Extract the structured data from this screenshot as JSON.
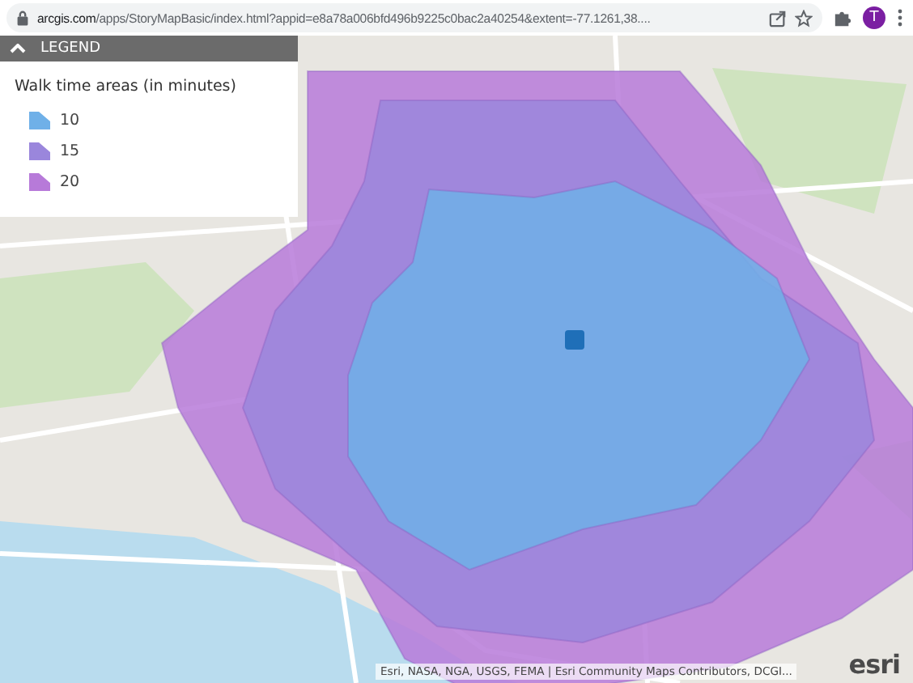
{
  "browser": {
    "url_domain": "arcgis.com",
    "url_path": "/apps/StoryMapBasic/index.html?appid=e8a78a006bfd496b9225c0bac2a40254&extent=-77.1261,38....",
    "avatar": "T"
  },
  "legend": {
    "title": "LEGEND",
    "expanded": true,
    "heading": "Walk time areas (in minutes)",
    "items": [
      {
        "label": "10",
        "color": "#6fb0e8"
      },
      {
        "label": "15",
        "color": "#9a86dc"
      },
      {
        "label": "20",
        "color": "#b77ad9"
      }
    ]
  },
  "map": {
    "attribution": "Esri, NASA, NGA, USGS, FEMA | Esri Community Maps Contributors, DCGI...",
    "logo": "esri"
  }
}
